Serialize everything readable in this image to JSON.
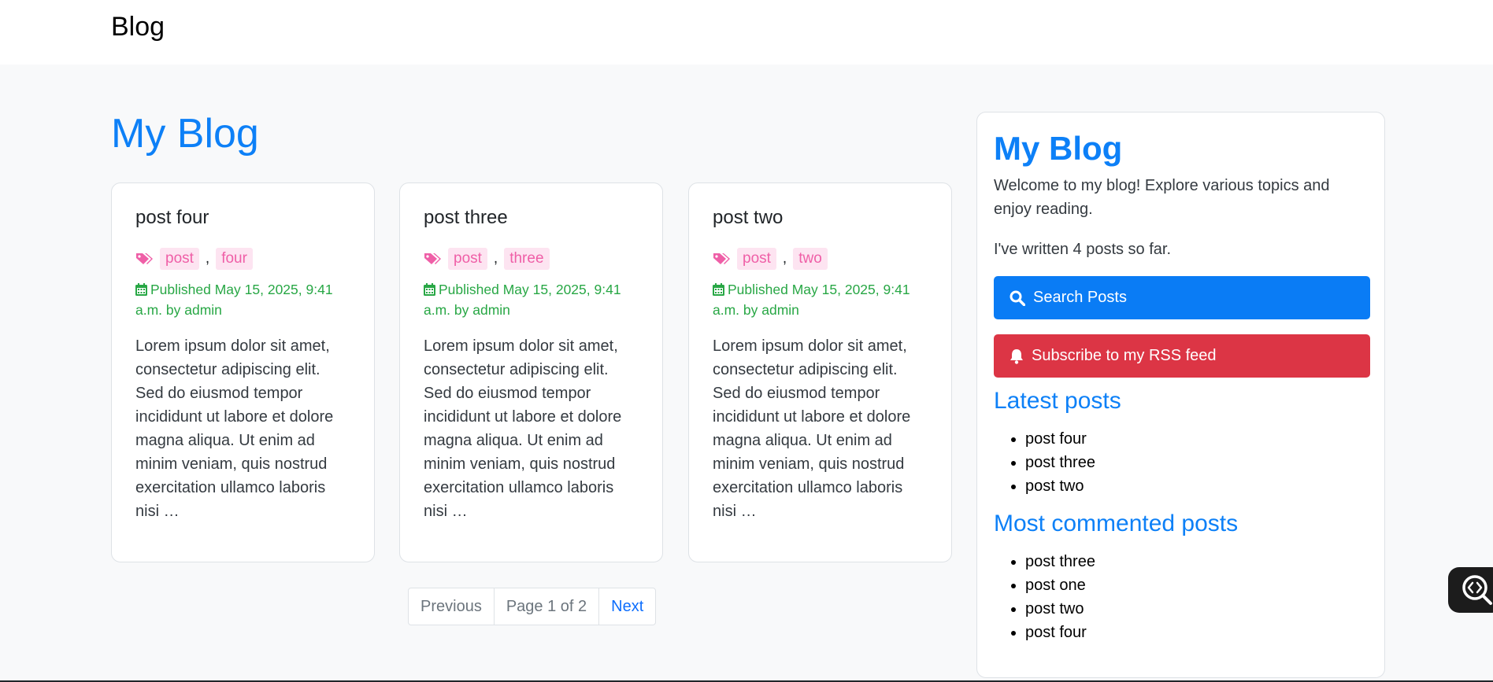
{
  "navbar": {
    "brand": "Blog"
  },
  "page": {
    "heading": "My Blog"
  },
  "posts": [
    {
      "title": "post four",
      "tags": [
        "post",
        "four"
      ],
      "meta": "Published May 15, 2025, 9:41 a.m. by admin",
      "excerpt": "Lorem ipsum dolor sit amet, consectetur adipiscing elit. Sed do eiusmod tempor incididunt ut labore et dolore magna aliqua. Ut enim ad minim veniam, quis nostrud exercitation ullamco laboris nisi …"
    },
    {
      "title": "post three",
      "tags": [
        "post",
        "three"
      ],
      "meta": "Published May 15, 2025, 9:41 a.m. by admin",
      "excerpt": "Lorem ipsum dolor sit amet, consectetur adipiscing elit. Sed do eiusmod tempor incididunt ut labore et dolore magna aliqua. Ut enim ad minim veniam, quis nostrud exercitation ullamco laboris nisi …"
    },
    {
      "title": "post two",
      "tags": [
        "post",
        "two"
      ],
      "meta": "Published May 15, 2025, 9:41 a.m. by admin",
      "excerpt": "Lorem ipsum dolor sit amet, consectetur adipiscing elit. Sed do eiusmod tempor incididunt ut labore et dolore magna aliqua. Ut enim ad minim veniam, quis nostrud exercitation ullamco laboris nisi …"
    }
  ],
  "pagination": {
    "previous": "Previous",
    "current": "Page 1 of 2",
    "next": "Next"
  },
  "sidebar": {
    "title": "My Blog",
    "welcome": "Welcome to my blog! Explore various topics and enjoy reading.",
    "count": "I've written 4 posts so far.",
    "search_button": "Search Posts",
    "rss_button": "Subscribe to my RSS feed",
    "latest_heading": "Latest posts",
    "latest": [
      "post four",
      "post three",
      "post two"
    ],
    "commented_heading": "Most commented posts",
    "commented": [
      "post three",
      "post one",
      "post two",
      "post four"
    ]
  },
  "icons": {
    "tag": "tags-icon",
    "calendar": "calendar-icon",
    "search": "search-icon",
    "bell": "bell-icon",
    "inspector": "code-search-icon"
  },
  "colors": {
    "accent": "#0d80f7",
    "tag_bg": "#fde4f1",
    "tag_text": "#ef5fa7",
    "meta": "#28a745",
    "search_btn": "#0a7cf5",
    "rss_btn": "#dc3545"
  }
}
